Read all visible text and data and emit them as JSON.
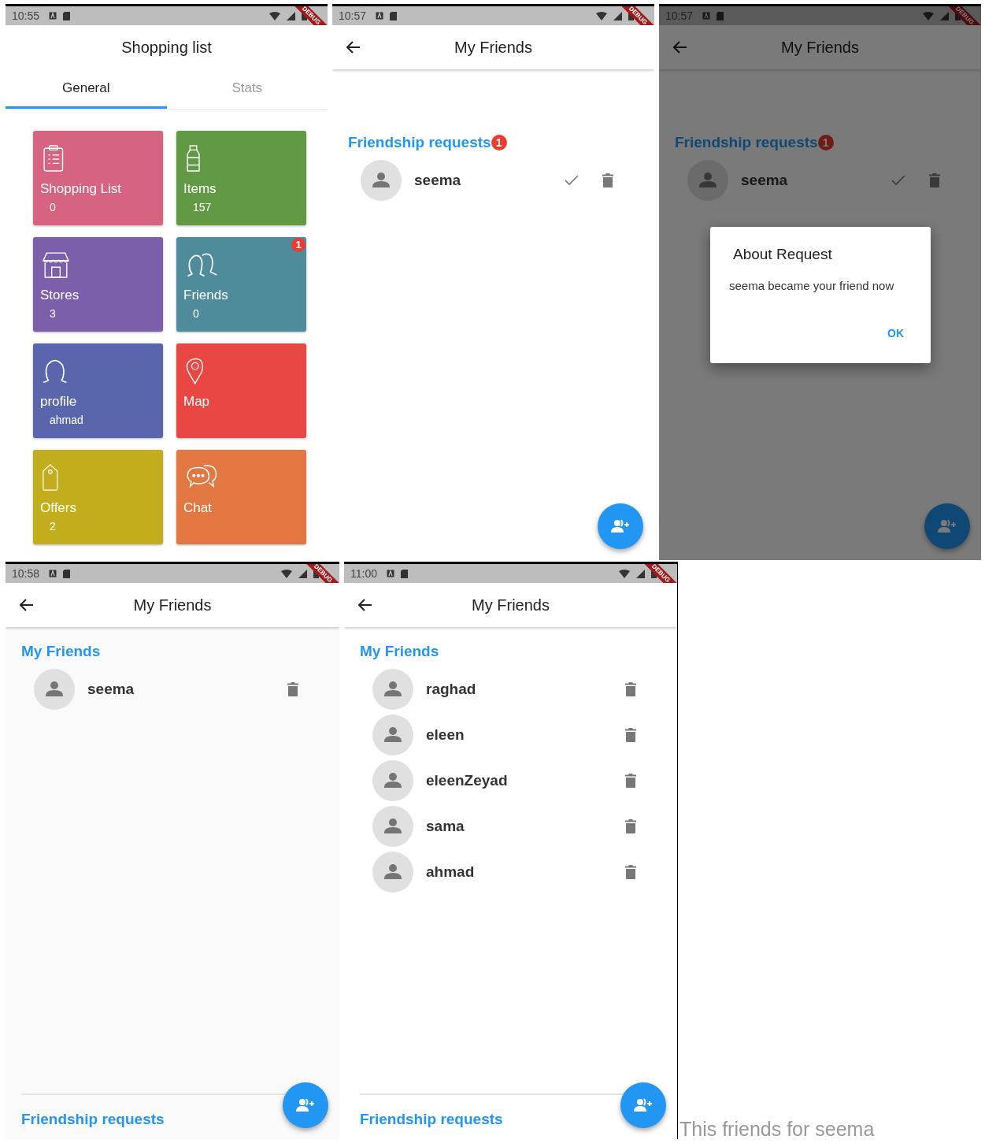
{
  "screens": [
    {
      "kind": "home",
      "status_time": "10:55",
      "debug_label": "DEBUG",
      "title": "Shopping list",
      "friend_request_badge": "1",
      "tabs": [
        {
          "label": "General",
          "selected": true
        },
        {
          "label": "Stats",
          "selected": false
        }
      ],
      "tiles": [
        {
          "kind": "list",
          "label": "Shopping List",
          "value": "0",
          "color": "#d6637f"
        },
        {
          "kind": "items",
          "label": "Items",
          "value": "157",
          "color": "#619945"
        },
        {
          "kind": "stores",
          "label": "Stores",
          "value": "3",
          "color": "#7c5faa"
        },
        {
          "kind": "friends",
          "label": "Friends",
          "value": "0",
          "color": "#4e8c9c"
        },
        {
          "kind": "profile",
          "label": "profile",
          "value": "ahmad",
          "color": "#5a66ab"
        },
        {
          "kind": "map",
          "label": "Map",
          "color": "#e84743"
        },
        {
          "kind": "offers",
          "label": "Offers",
          "value": "2",
          "color": "#c2ae1c"
        },
        {
          "kind": "chat",
          "label": "Chat",
          "color": "#e27742"
        }
      ]
    },
    {
      "kind": "friends",
      "status_time": "10:57",
      "debug_label": "DEBUG",
      "title": "My Friends",
      "sections": [
        {
          "title": "Friendship requests",
          "badge": "1",
          "items": [
            {
              "name": "seema",
              "kind": "request"
            }
          ]
        }
      ]
    },
    {
      "kind": "friends",
      "status_time": "10:57",
      "debug_label": "DEBUG",
      "title": "My Friends",
      "sections": [
        {
          "title": "Friendship requests",
          "badge": "1",
          "items": [
            {
              "name": "seema",
              "kind": "request"
            }
          ]
        }
      ],
      "dialog": {
        "title": "About Request",
        "message": "seema became your friend now",
        "button": "OK"
      }
    },
    {
      "kind": "friends",
      "status_time": "10:58",
      "debug_label": "DEBUG",
      "title": "My Friends",
      "sections": [
        {
          "title": "My Friends",
          "items": [
            {
              "name": "seema",
              "kind": "friend"
            }
          ]
        }
      ],
      "footer_link": "Friendship requests"
    },
    {
      "kind": "friends",
      "status_time": "11:00",
      "debug_label": "DEBUG",
      "title": "My Friends",
      "sections": [
        {
          "title": "My Friends",
          "items": [
            {
              "name": "raghad",
              "kind": "friend"
            },
            {
              "name": "eleen",
              "kind": "friend"
            },
            {
              "name": "eleenZeyad",
              "kind": "friend"
            },
            {
              "name": "sama",
              "kind": "friend"
            },
            {
              "name": "ahmad",
              "kind": "friend"
            }
          ]
        }
      ],
      "footer_link": "Friendship requests"
    }
  ],
  "caption": "This friends for seema"
}
